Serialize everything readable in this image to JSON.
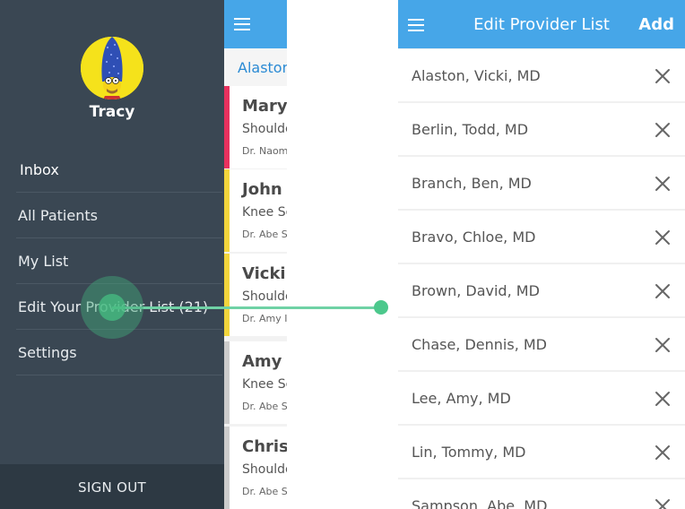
{
  "drawer": {
    "user_name": "Tracy",
    "menu": [
      {
        "label": "Inbox",
        "active": true
      },
      {
        "label": "All Patients"
      },
      {
        "label": "My List"
      },
      {
        "label": "Edit Your Provider List (21)"
      },
      {
        "label": "Settings"
      }
    ],
    "signout_label": "SIGN OUT",
    "colors": {
      "background": "#3a4753",
      "footer": "#2d3943"
    }
  },
  "patients_list": {
    "menu_icon": "hamburger-icon",
    "section_header": "Alaston",
    "patients": [
      {
        "name": "Mary J",
        "condition": "Shoulder",
        "doctor": "Dr. Naomi",
        "stripe_color": "#e8315e"
      },
      {
        "name": "John S",
        "condition": "Knee Sc",
        "doctor": "Dr. Abe S",
        "stripe_color": "#f2d53c"
      },
      {
        "name": "Vicki I",
        "condition": "Shoulder",
        "doctor": "Dr. Amy I",
        "stripe_color": "#f2d53c"
      },
      {
        "name": "Amy L",
        "condition": "Knee Sc",
        "doctor": "Dr. Abe S",
        "stripe_color": "#cccccc"
      },
      {
        "name": "Christ",
        "condition": "Shoulder",
        "doctor": "Dr. Abe S",
        "stripe_color": "#cccccc"
      }
    ]
  },
  "provider_panel": {
    "title": "Edit Provider List",
    "menu_icon": "hamburger-icon",
    "add_label": "Add",
    "remove_icon": "close-icon",
    "providers": [
      "Alaston, Vicki, MD",
      "Berlin, Todd, MD",
      "Branch, Ben, MD",
      "Bravo, Chloe, MD",
      "Brown, David, MD",
      "Chase, Dennis, MD",
      "Lee, Amy, MD",
      "Lin, Tommy, MD",
      "Sampson, Abe, MD"
    ]
  },
  "colors": {
    "header_blue": "#46a6e8",
    "link_blue": "#2a8ad4",
    "gesture_green": "#4cc88c"
  }
}
